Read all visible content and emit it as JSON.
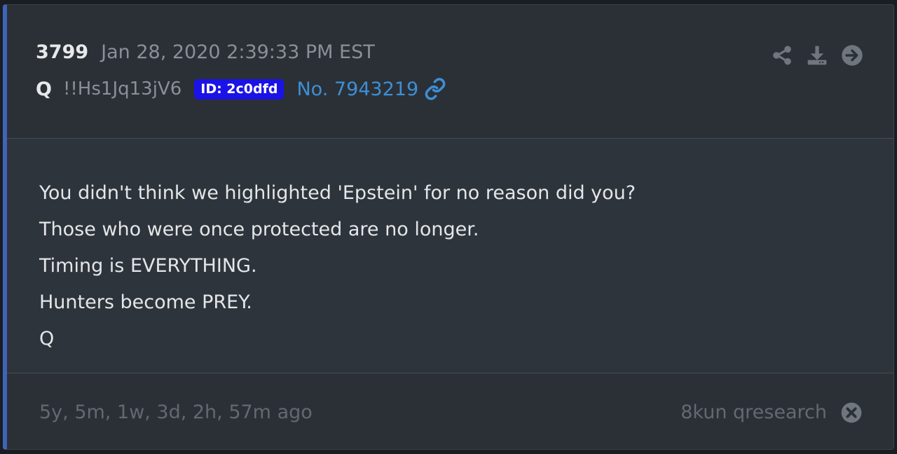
{
  "post": {
    "number": "3799",
    "date": "Jan 28, 2020 2:39:33 PM EST",
    "author": "Q",
    "tripcode": "!!Hs1Jq13jV6",
    "id_badge": "ID: 2c0dfd",
    "post_no": "No. 7943219"
  },
  "actions": [
    {
      "icon": "share-icon"
    },
    {
      "icon": "download-icon"
    },
    {
      "icon": "arrow-right-circle-icon"
    }
  ],
  "body": {
    "lines": [
      "You didn't think we highlighted 'Epstein' for no reason did you?",
      "Those who were once protected are no longer.",
      "Timing is EVERYTHING.",
      "Hunters become PREY.",
      "Q"
    ]
  },
  "footer": {
    "ago": "5y, 5m, 1w, 3d, 2h, 57m ago",
    "source": "8kun qresearch"
  },
  "colors": {
    "accent_border": "#3f64b8",
    "id_badge_bg": "#1a12e6",
    "link": "#3d8fd6"
  }
}
